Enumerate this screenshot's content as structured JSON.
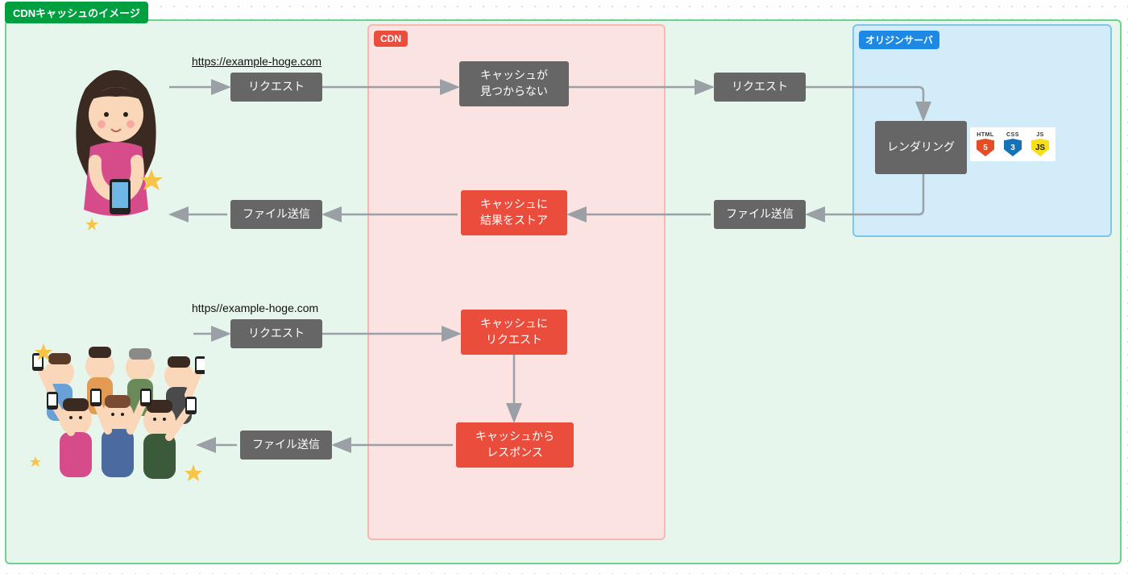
{
  "title": "CDNキャッシュのイメージ",
  "regions": {
    "cdn": {
      "label": "CDN"
    },
    "origin": {
      "label": "オリジンサーバ"
    }
  },
  "urls": {
    "first": "https://example-hoge.com",
    "second": "https//example-hoge.com"
  },
  "nodes": {
    "req1": "リクエスト",
    "cacheMiss": "キャッシュが\n見つからない",
    "req2": "リクエスト",
    "rendering": "レンダリング",
    "fileSend1": "ファイル送信",
    "cacheStore": "キャッシュに\n結果をストア",
    "fileSend2": "ファイル送信",
    "req3": "リクエスト",
    "cacheReq": "キャッシュに\nリクエスト",
    "cacheResp": "キャッシュから\nレスポンス",
    "fileSend3": "ファイル送信"
  },
  "tech": {
    "html": {
      "label": "HTML",
      "glyph": "5"
    },
    "css": {
      "label": "CSS",
      "glyph": "3"
    },
    "js": {
      "label": "JS",
      "glyph": "JS"
    }
  },
  "colors": {
    "frameBorder": "#6dd18f",
    "frameFill": "#e7f6ec",
    "cdnFill": "#fbe3e1",
    "cdnBorder": "#f6b8b0",
    "cdnAccent": "#eb4d3d",
    "originFill": "#d3ecf9",
    "originBorder": "#7fc6ea",
    "originAccent": "#1e88e5",
    "nodeGray": "#666666",
    "arrow": "#9aa0a6"
  }
}
